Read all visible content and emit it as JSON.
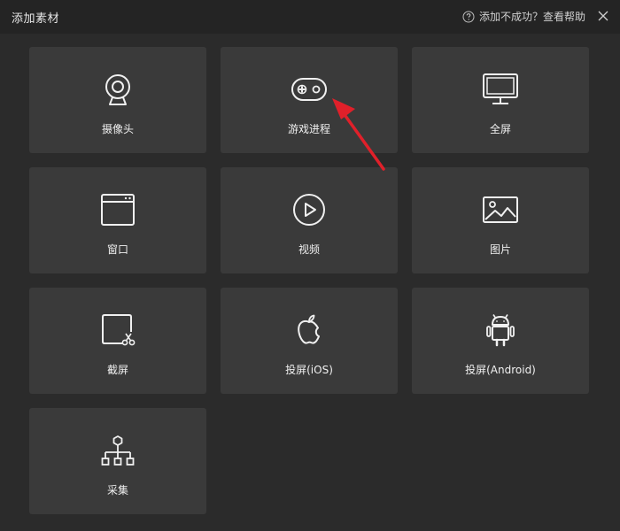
{
  "window": {
    "title": "添加素材",
    "help_text": "添加不成功？查看帮助",
    "help_icon": "question-circle-icon",
    "close_icon": "close-icon"
  },
  "tiles": [
    {
      "label": "摄像头",
      "icon": "webcam-icon"
    },
    {
      "label": "游戏进程",
      "icon": "gamepad-icon"
    },
    {
      "label": "全屏",
      "icon": "monitor-icon"
    },
    {
      "label": "窗口",
      "icon": "window-icon"
    },
    {
      "label": "视频",
      "icon": "play-circle-icon"
    },
    {
      "label": "图片",
      "icon": "image-icon"
    },
    {
      "label": "截屏",
      "icon": "screenshot-scissors-icon"
    },
    {
      "label": "投屏(iOS)",
      "icon": "apple-icon"
    },
    {
      "label": "投屏(Android)",
      "icon": "android-icon"
    },
    {
      "label": "采集",
      "icon": "hierarchy-icon"
    }
  ],
  "colors": {
    "background": "#2b2b2b",
    "titlebar": "#242424",
    "tile": "#3a3a3a",
    "annotation_arrow": "#e0202a"
  }
}
